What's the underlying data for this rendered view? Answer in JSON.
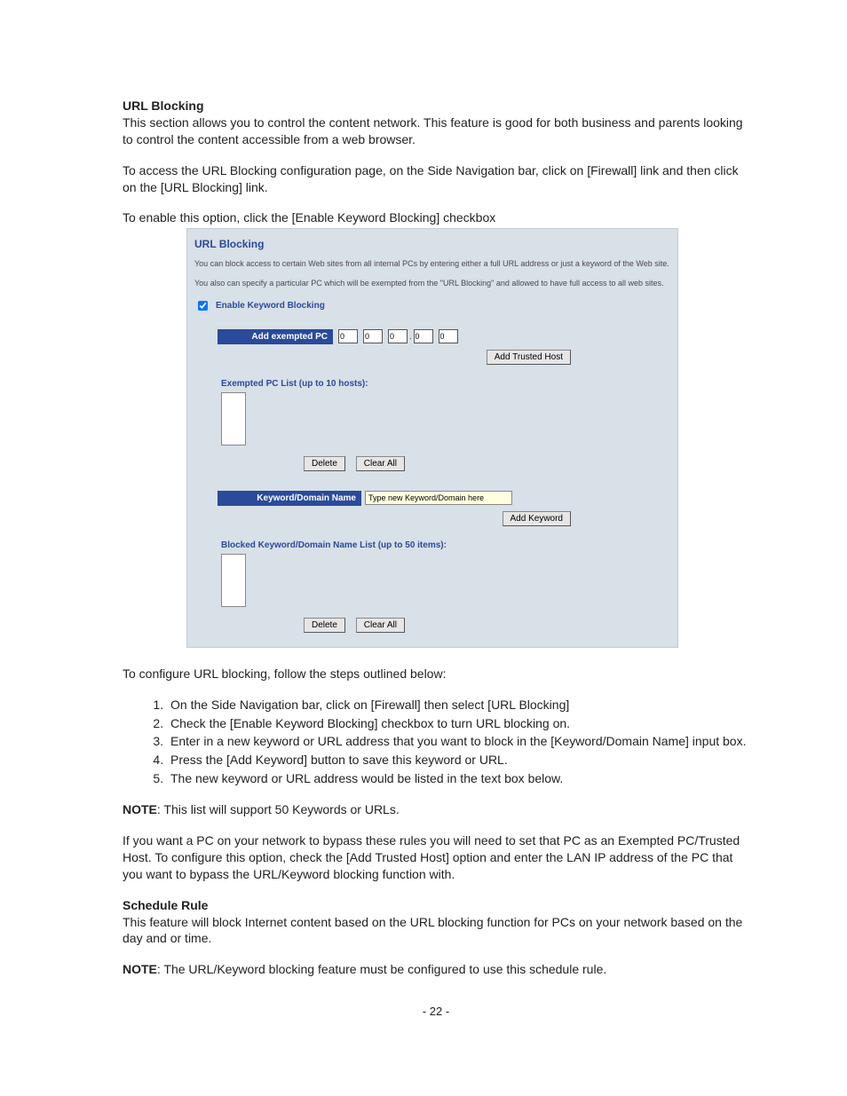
{
  "doc": {
    "h1": "URL Blocking",
    "p1": "This section allows you to control the content network. This feature is good for both business and parents looking to control the content accessible from a web browser.",
    "p2": "To access the URL Blocking configuration page, on the Side Navigation bar, click on [Firewall] link and then click on the [URL Blocking] link.",
    "p3": "To enable this option, click the [Enable Keyword Blocking] checkbox",
    "p4": "To configure URL blocking, follow the steps outlined below:",
    "steps": [
      "On the Side Navigation bar, click on [Firewall] then select [URL Blocking]",
      "Check the [Enable Keyword Blocking] checkbox to turn URL blocking on.",
      "Enter in a new keyword or URL address that you want to block in the [Keyword/Domain Name] input box.",
      "Press the [Add Keyword] button to save this keyword or URL.",
      "The new keyword or URL address would be listed in the text box below."
    ],
    "note_label": "NOTE",
    "note1_rest": ": This list will support 50 Keywords or URLs.",
    "p5": "If you want a PC on your network to bypass these rules you will need to set that PC as an Exempted PC/Trusted Host.  To configure this option, check the [Add Trusted Host] option and enter the LAN IP address of the PC that you want to bypass the URL/Keyword blocking function with.",
    "h2": "Schedule Rule",
    "p6": "This feature will block Internet content based on the URL blocking function for PCs on your network based on the day and or time.",
    "note2_rest": ": The URL/Keyword blocking feature must be configured to use this schedule rule.",
    "page_number": "- 22 -"
  },
  "panel": {
    "title": "URL Blocking",
    "intro1": "You can block access to certain Web sites from all internal PCs by entering either a full URL address or just a keyword of the Web site.",
    "intro2": "You also can specify a particular PC which will be exempted from the \"URL Blocking\" and allowed to have full access to all web sites.",
    "enable_label": "Enable Keyword Blocking",
    "add_exempted_header": "Add exempted PC",
    "ip": {
      "a": "0",
      "b": "0",
      "c": "0",
      "d": "0",
      "e": "0"
    },
    "add_trusted_btn": "Add Trusted Host",
    "exempted_list_label": "Exempted PC List (up to 10 hosts):",
    "delete_btn": "Delete",
    "clear_all_btn": "Clear All",
    "keyword_header": "Keyword/Domain Name",
    "keyword_placeholder": "Type new Keyword/Domain here",
    "add_keyword_btn": "Add Keyword",
    "blocked_list_label": "Blocked Keyword/Domain Name List (up to 50 items):"
  }
}
